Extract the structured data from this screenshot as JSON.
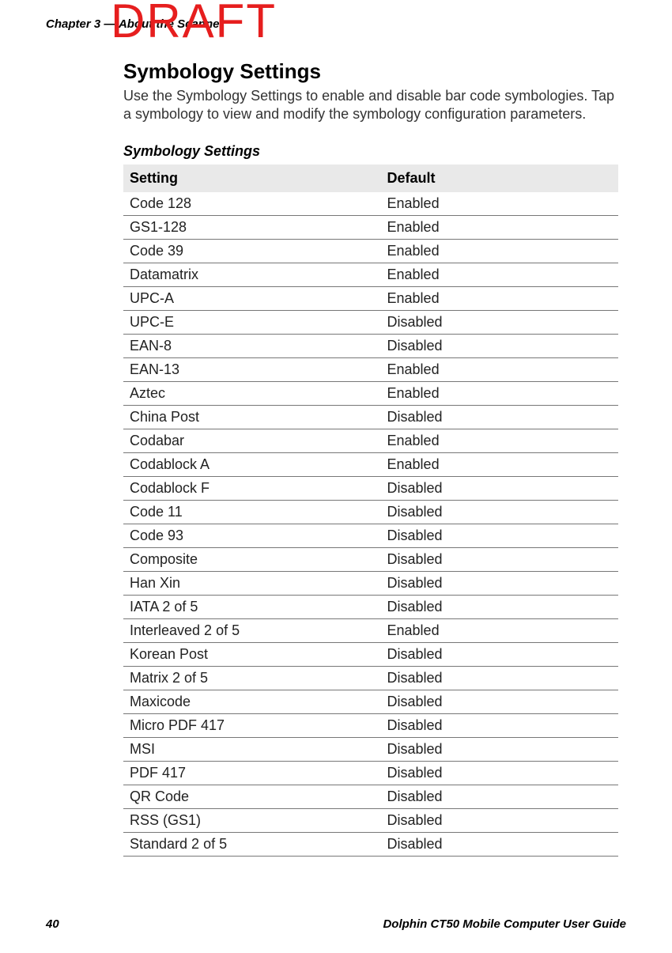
{
  "header": {
    "chapter": "Chapter 3 — About the Scanner"
  },
  "watermark": "DRAFT",
  "section": {
    "title": "Symbology Settings",
    "description": "Use the Symbology Settings to enable and disable bar code symbologies. Tap a symbology to view and modify the symbology configuration parameters."
  },
  "table": {
    "caption": "Symbology Settings",
    "headers": {
      "col1": "Setting",
      "col2": "Default"
    },
    "rows": [
      {
        "setting": "Code 128",
        "default": "Enabled"
      },
      {
        "setting": "GS1-128",
        "default": "Enabled"
      },
      {
        "setting": "Code 39",
        "default": "Enabled"
      },
      {
        "setting": "Datamatrix",
        "default": "Enabled"
      },
      {
        "setting": "UPC-A",
        "default": "Enabled"
      },
      {
        "setting": "UPC-E",
        "default": "Disabled"
      },
      {
        "setting": "EAN-8",
        "default": "Disabled"
      },
      {
        "setting": "EAN-13",
        "default": "Enabled"
      },
      {
        "setting": "Aztec",
        "default": "Enabled"
      },
      {
        "setting": "China Post",
        "default": "Disabled"
      },
      {
        "setting": "Codabar",
        "default": "Enabled"
      },
      {
        "setting": "Codablock A",
        "default": "Enabled"
      },
      {
        "setting": "Codablock F",
        "default": "Disabled"
      },
      {
        "setting": "Code 11",
        "default": "Disabled"
      },
      {
        "setting": "Code 93",
        "default": "Disabled"
      },
      {
        "setting": "Composite",
        "default": "Disabled"
      },
      {
        "setting": "Han Xin",
        "default": "Disabled"
      },
      {
        "setting": "IATA 2 of 5",
        "default": "Disabled"
      },
      {
        "setting": "Interleaved 2 of 5",
        "default": "Enabled"
      },
      {
        "setting": "Korean Post",
        "default": "Disabled"
      },
      {
        "setting": "Matrix 2 of 5",
        "default": "Disabled"
      },
      {
        "setting": "Maxicode",
        "default": "Disabled"
      },
      {
        "setting": "Micro PDF 417",
        "default": "Disabled"
      },
      {
        "setting": "MSI",
        "default": "Disabled"
      },
      {
        "setting": "PDF 417",
        "default": "Disabled"
      },
      {
        "setting": "QR Code",
        "default": "Disabled"
      },
      {
        "setting": "RSS (GS1)",
        "default": "Disabled"
      },
      {
        "setting": "Standard 2 of 5",
        "default": "Disabled"
      }
    ]
  },
  "footer": {
    "page_number": "40",
    "guide_title": "Dolphin CT50 Mobile Computer User Guide"
  }
}
